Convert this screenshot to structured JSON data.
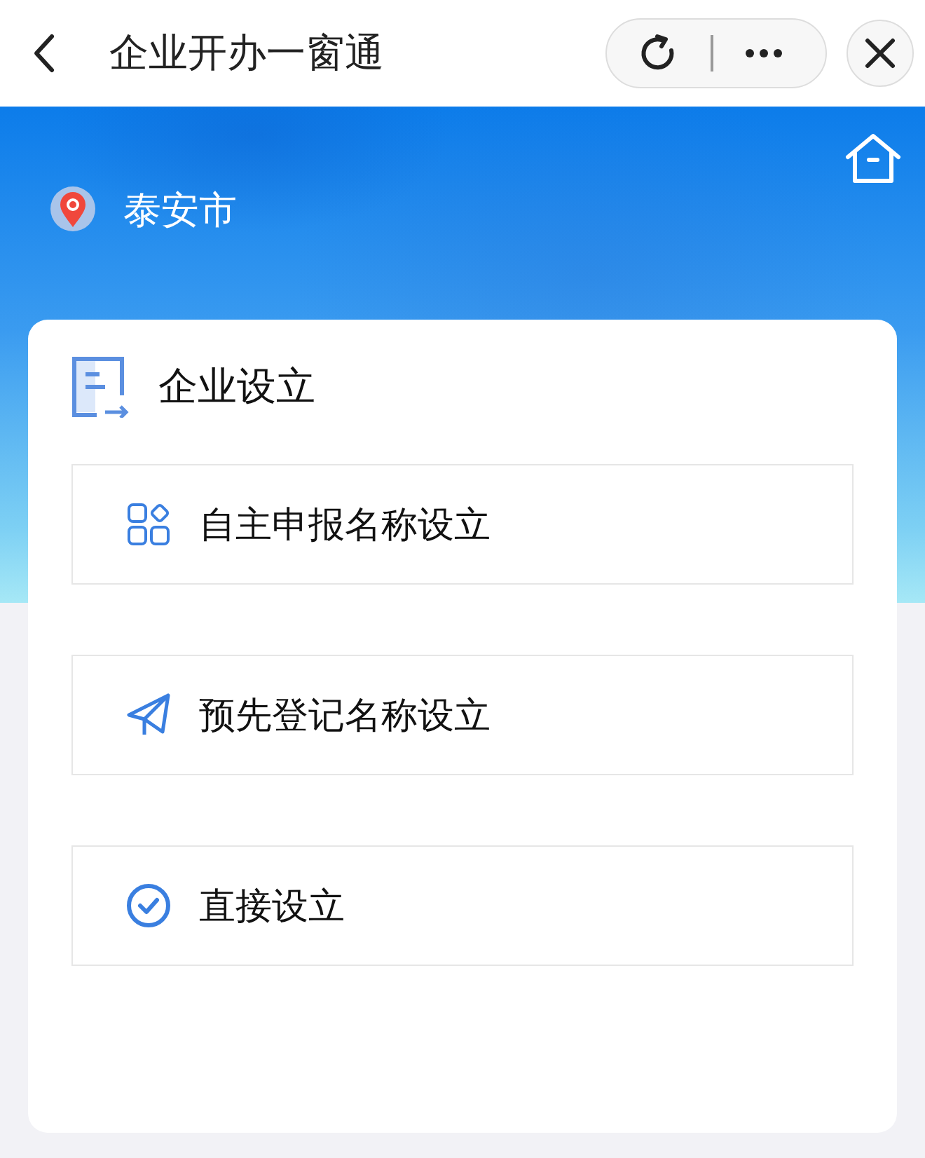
{
  "nav": {
    "title": "企业开办一窗通"
  },
  "location": {
    "city": "泰安市"
  },
  "section": {
    "title": "企业设立",
    "items": [
      {
        "kind": "grid",
        "label": "自主申报名称设立"
      },
      {
        "kind": "send",
        "label": "预先登记名称设立"
      },
      {
        "kind": "check",
        "label": "直接设立"
      }
    ]
  }
}
